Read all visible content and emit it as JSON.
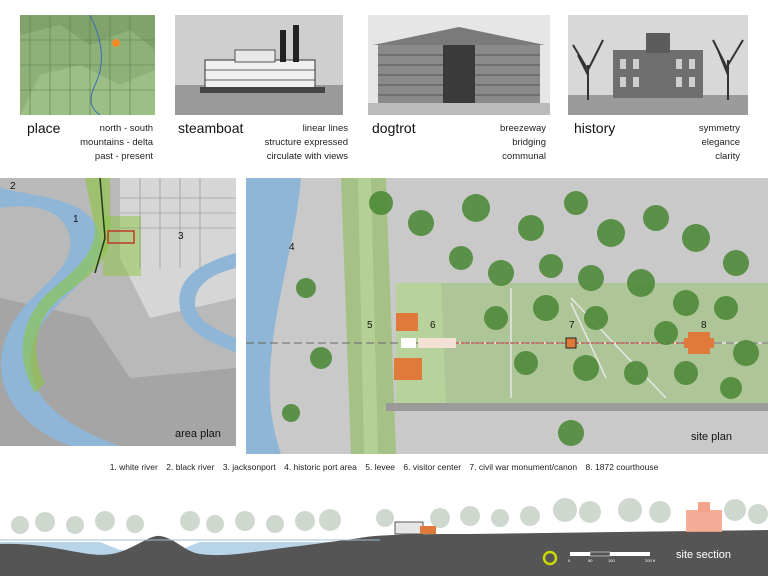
{
  "concepts": [
    {
      "title": "place",
      "lines": [
        "north - south",
        "mountains - delta",
        "past - present"
      ]
    },
    {
      "title": "steamboat",
      "lines": [
        "linear lines",
        "structure expressed",
        "circulate with views"
      ]
    },
    {
      "title": "dogtrot",
      "lines": [
        "breezeway",
        "bridging",
        "communal"
      ]
    },
    {
      "title": "history",
      "lines": [
        "symmetry",
        "elegance",
        "clarity"
      ]
    }
  ],
  "area_plan": {
    "label": "area plan",
    "markers": [
      "1",
      "2",
      "3"
    ]
  },
  "site_plan": {
    "label": "site plan",
    "markers": [
      "4",
      "5",
      "6",
      "7",
      "8"
    ]
  },
  "legend": [
    "1. white river",
    "2. black river",
    "3. jacksonport",
    "4. historic port area",
    "5. levee",
    "6. visitor center",
    "7. civil war monument/canon",
    "8. 1872 courthouse"
  ],
  "section": {
    "label": "site section",
    "scale_ticks": [
      "0",
      "50",
      "100",
      "200 ft"
    ]
  },
  "colors": {
    "river": "#8fb6d6",
    "green_overlay": "#8cc63f",
    "building": "#e07a3a",
    "axis_line": "#c0392b"
  }
}
